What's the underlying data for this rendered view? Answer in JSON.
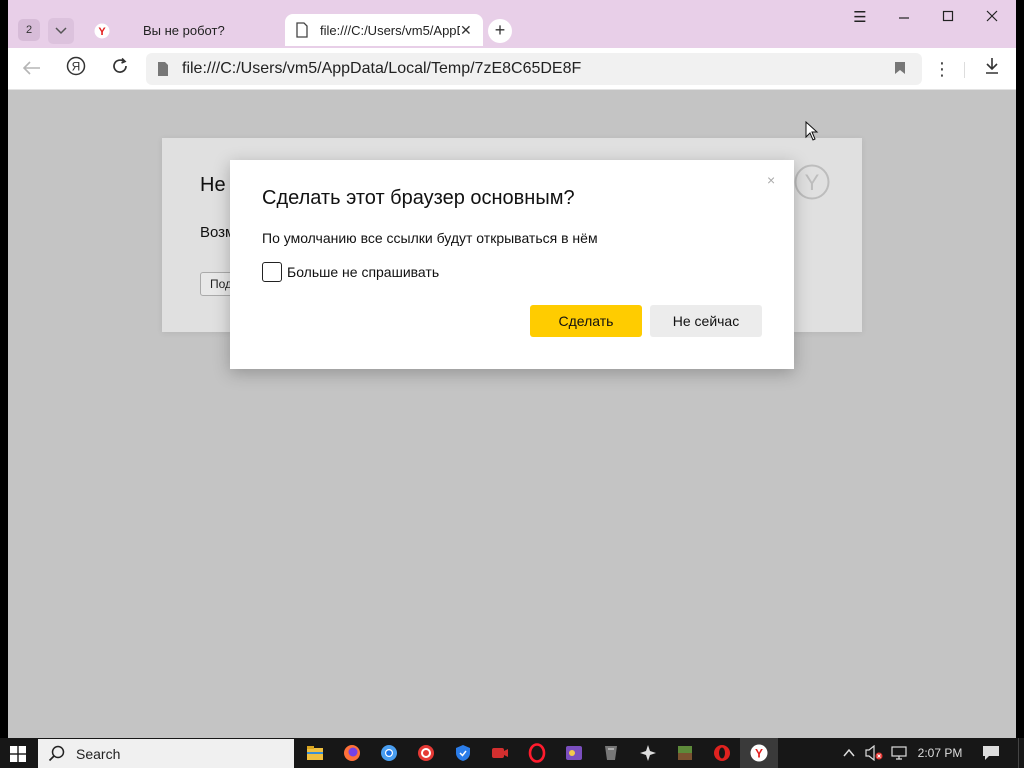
{
  "window": {
    "tab_count": "2",
    "tabs": [
      {
        "title": "Вы не робот?",
        "active": false
      },
      {
        "title": "file:///C:/Users/vm5/AppData/Local/Temp/7zE8C65DE8F",
        "active": true
      }
    ],
    "new_tab_label": "+"
  },
  "toolbar": {
    "address": "file:///C:/Users/vm5/AppData/Local/Temp/7zE8C65DE8F"
  },
  "page": {
    "card_title": "Не",
    "card_text": "Возм",
    "card_button": "Под"
  },
  "dialog": {
    "title": "Сделать этот браузер основным?",
    "description": "По умолчанию все ссылки будут открываться в нём",
    "checkbox_label": "Больше не спрашивать",
    "checkbox_checked": false,
    "primary_button": "Сделать",
    "secondary_button": "Не сейчас",
    "close_label": "×"
  },
  "taskbar": {
    "search_label": "Search",
    "clock": "2:07 PM",
    "apps": [
      "file-explorer-icon",
      "firefox-icon",
      "chrome-icon",
      "red-app-icon",
      "defender-icon",
      "video-app-icon",
      "opera-icon",
      "game-app-icon",
      "wot-icon",
      "cross-app-icon",
      "minecraft-icon",
      "opera-gx-icon",
      "yandex-browser-icon"
    ]
  },
  "colors": {
    "tabbar": "#e8cfe8",
    "primary_button": "#ffcc00",
    "page_dim": "#c4c4c4"
  }
}
